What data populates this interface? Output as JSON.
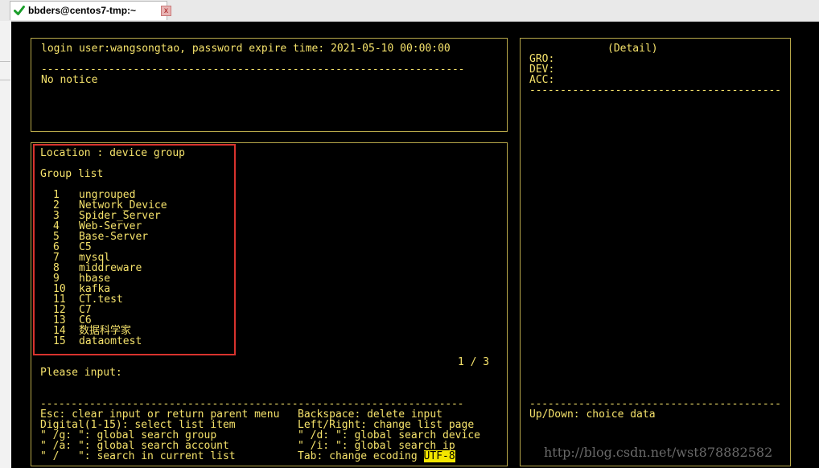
{
  "window": {
    "tab_title": "bbders@centos7-tmp:~",
    "tab_close_label": "x"
  },
  "notice_panel": {
    "login_line": "login user:wangsongtao, password expire time: 2021-05-10 00:00:00",
    "separator": "---------------------------------------------------------------------",
    "notice": "No notice"
  },
  "list_panel": {
    "location": "Location : device group",
    "heading": "Group list",
    "items": [
      {
        "num": "1",
        "name": "ungrouped"
      },
      {
        "num": "2",
        "name": "Network_Device"
      },
      {
        "num": "3",
        "name": "Spider_Server"
      },
      {
        "num": "4",
        "name": "Web-Server"
      },
      {
        "num": "5",
        "name": "Base-Server"
      },
      {
        "num": "6",
        "name": "C5"
      },
      {
        "num": "7",
        "name": "mysql"
      },
      {
        "num": "8",
        "name": "middreware"
      },
      {
        "num": "9",
        "name": "hbase"
      },
      {
        "num": "10",
        "name": "kafka"
      },
      {
        "num": "11",
        "name": "CT.test"
      },
      {
        "num": "12",
        "name": "C7"
      },
      {
        "num": "13",
        "name": "C6"
      },
      {
        "num": "14",
        "name": "数据科学家"
      },
      {
        "num": "15",
        "name": "dataomtest"
      }
    ],
    "page_indicator": "1 / 3",
    "input_prompt": "Please input:",
    "separator": "---------------------------------------------------------------------",
    "help": {
      "left": [
        "Esc: clear input or return parent menu",
        "Digital(1-15): select list item",
        "\" /g: \": global search group",
        "\" /a: \": global search account",
        "\" /   \": search in current list"
      ],
      "right": [
        "Backspace: delete input",
        "Left/Right: change list page",
        "\" /d: \": global search device",
        "\" /i: \": global search ip",
        "Tab: change ecoding "
      ],
      "encoding": "UTF-8"
    }
  },
  "detail_panel": {
    "title": "(Detail)",
    "fields": [
      "GRO:",
      "DEV:",
      "ACC:"
    ],
    "separator": "-----------------------------------------",
    "hint": "Up/Down: choice data"
  },
  "watermark": "http://blog.csdn.net/wst878882582",
  "colors": {
    "terminal_bg": "#000000",
    "terminal_text": "#f5e26b",
    "panel_border": "#b8a84a",
    "highlight_bg": "#f3e600",
    "selection_box": "#d8332e",
    "tab_check": "#1a9e2a"
  }
}
